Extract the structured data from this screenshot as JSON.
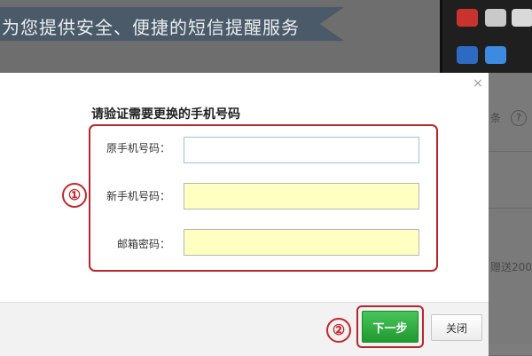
{
  "background": {
    "banner_text": "为您提供安全、便捷的短信提醒服务",
    "right_partial_text_1": "条",
    "right_partial_text_2": "赠送200",
    "help_icon_glyph": "?"
  },
  "dialog": {
    "close_glyph": "×",
    "title": "请验证需要更换的手机号码",
    "fields": [
      {
        "label": "原手机号码：",
        "value": ""
      },
      {
        "label": "新手机号码：",
        "value": ""
      },
      {
        "label": "邮箱密码：",
        "value": ""
      }
    ],
    "next_button": "下一步",
    "close_button": "关闭"
  },
  "annotations": {
    "marker_1": "①",
    "marker_2": "②",
    "accent_color": "#c3272d"
  },
  "colors": {
    "highlight_field": "#ffffc2",
    "next_button": "#2aaa3d"
  }
}
